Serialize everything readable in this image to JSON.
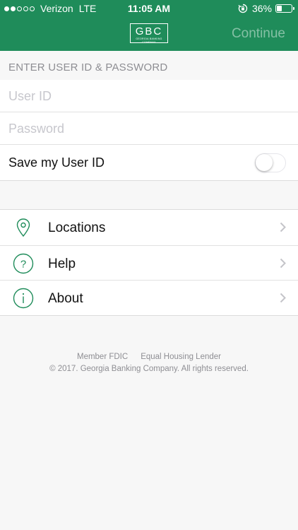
{
  "status_bar": {
    "signal_dots": [
      true,
      true,
      false,
      false,
      false
    ],
    "carrier": "Verizon",
    "network": "LTE",
    "time": "11:05 AM",
    "battery_percent": "36%",
    "battery_level": 0.36
  },
  "header": {
    "logo_text": "GBC",
    "logo_subtext": "Georgia Banking Company",
    "continue_label": "Continue",
    "bg_color": "#1f8c5a"
  },
  "login": {
    "section_title": "ENTER USER ID & PASSWORD",
    "user_id_placeholder": "User ID",
    "user_id_value": "",
    "password_placeholder": "Password",
    "password_value": "",
    "save_user_id_label": "Save my User ID",
    "save_user_id_on": false
  },
  "menu": {
    "items": [
      {
        "label": "Locations",
        "icon": "location-pin-icon"
      },
      {
        "label": "Help",
        "icon": "question-circle-icon"
      },
      {
        "label": "About",
        "icon": "info-circle-icon"
      }
    ]
  },
  "footer": {
    "member_fdic": "Member FDIC",
    "equal_housing": "Equal Housing Lender",
    "copyright": "© 2017. Georgia Banking Company. All rights reserved."
  }
}
